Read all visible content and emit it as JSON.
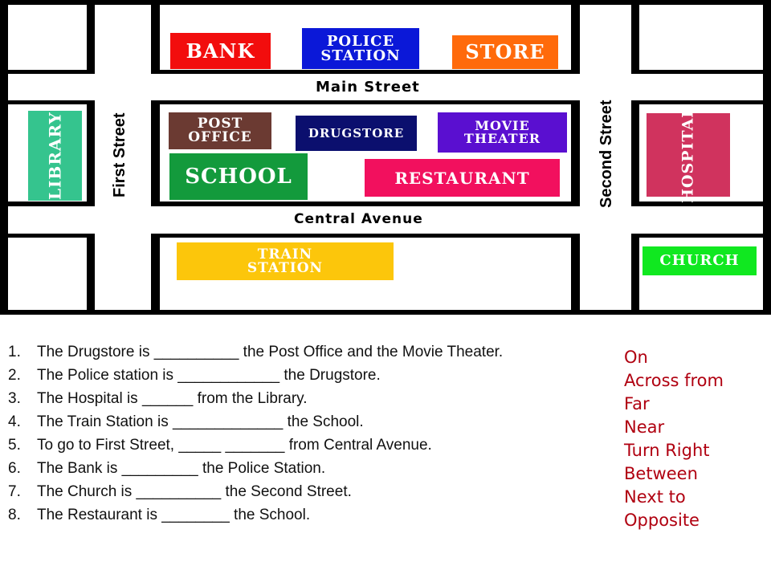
{
  "map": {
    "roads": {
      "main_street": "Main Street",
      "central_avenue": "Central Avenue",
      "first_street": "First Street",
      "second_street": "Second Street"
    },
    "places": {
      "bank": {
        "label": "BANK",
        "color": "#f20d0d"
      },
      "police_station": {
        "label": "POLICE STATION",
        "line1": "POLICE",
        "line2": "STATION",
        "color": "#0b18d8"
      },
      "store": {
        "label": "STORE",
        "color": "#ff6a0b"
      },
      "post_office": {
        "label": "POST OFFICE",
        "line1": "POST",
        "line2": "OFFICE",
        "color": "#6b3a32"
      },
      "drugstore": {
        "label": "DRUGSTORE",
        "color": "#0b0f6e"
      },
      "movie_theater": {
        "label": "MOVIE THEATER",
        "line1": "MOVIE",
        "line2": "THEATER",
        "color": "#5a0fd0"
      },
      "school": {
        "label": "SCHOOL",
        "color": "#139a3c"
      },
      "restaurant": {
        "label": "RESTAURANT",
        "color": "#f2105e"
      },
      "library": {
        "label": "LIBRARY",
        "color": "#35c48e"
      },
      "hospital": {
        "label": "HOSPITAL",
        "color": "#d0335e"
      },
      "train_station": {
        "label": "TRAIN STATION",
        "line1": "TRAIN",
        "line2": "STATION",
        "color": "#fcc60b"
      },
      "church": {
        "label": "CHURCH",
        "color": "#10e820"
      }
    }
  },
  "exercise": {
    "questions": [
      {
        "num": "1.",
        "text": "The Drugstore is __________ the Post Office and the Movie Theater."
      },
      {
        "num": "2.",
        "text": "The Police station is ____________ the Drugstore."
      },
      {
        "num": "3.",
        "text": "The Hospital is ______ from the Library."
      },
      {
        "num": "4.",
        "text": "The Train Station is _____________ the School."
      },
      {
        "num": "5.",
        "text": "To go to First Street, _____ _______ from Central Avenue."
      },
      {
        "num": "6.",
        "text": "The Bank is _________ the Police Station."
      },
      {
        "num": "7.",
        "text": "The Church is __________ the Second Street."
      },
      {
        "num": "8.",
        "text": "The Restaurant is ________ the School."
      }
    ],
    "word_bank": [
      "On",
      "Across from",
      "Far",
      "Near",
      "Turn Right",
      "Between",
      "Next to",
      "Opposite"
    ],
    "word_bank_color": "#b00010"
  }
}
